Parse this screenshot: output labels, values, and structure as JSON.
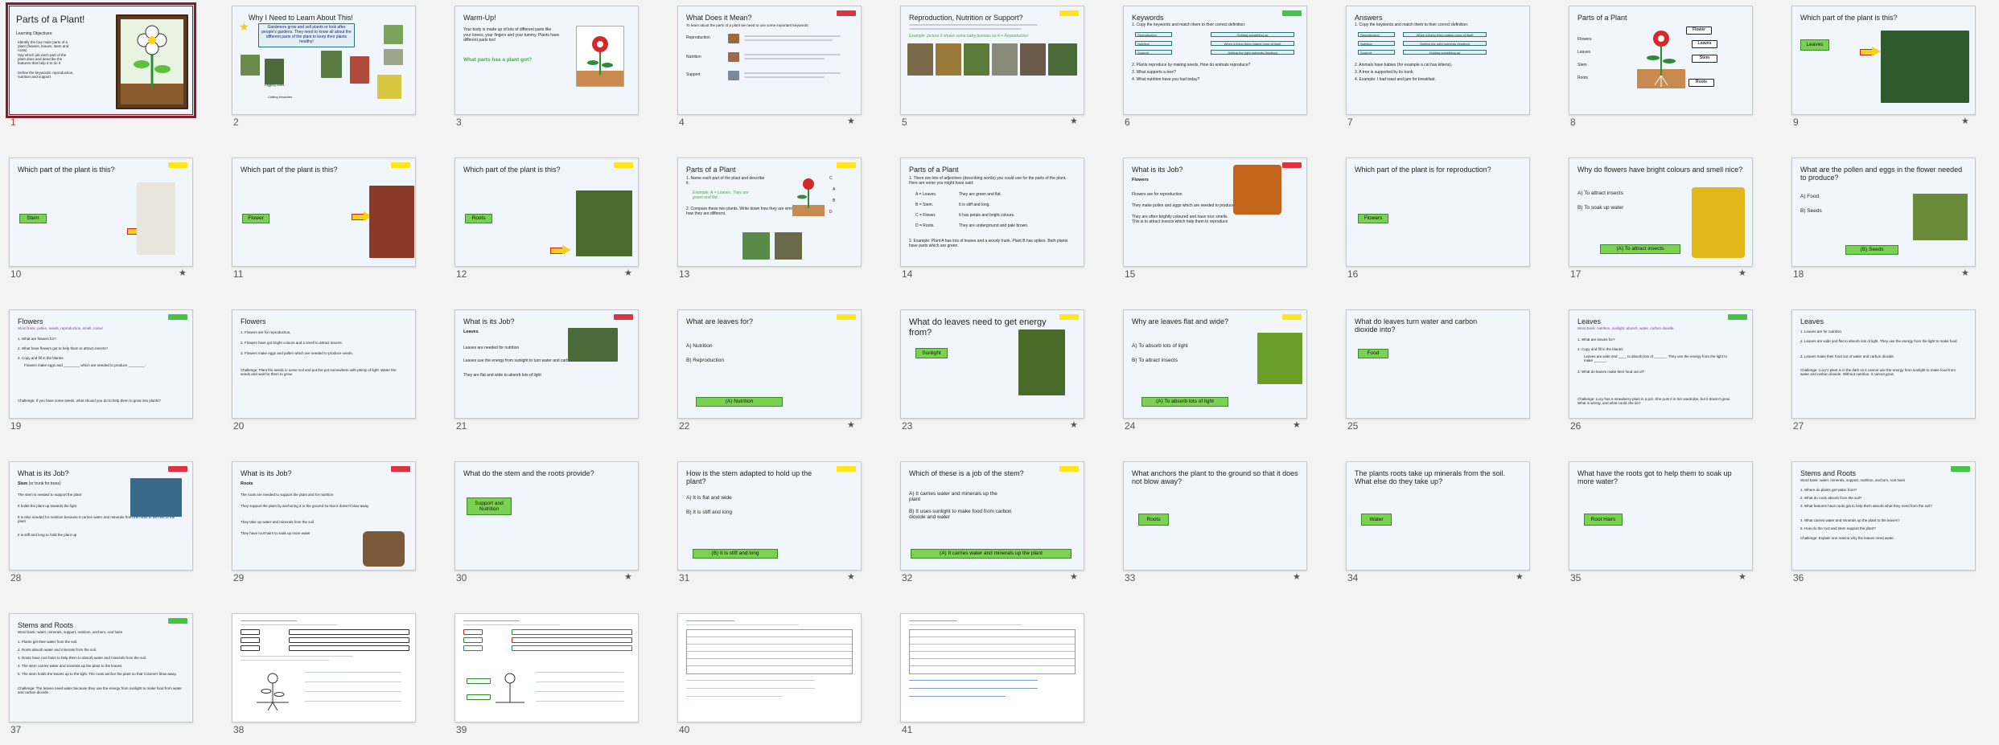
{
  "slides": [
    {
      "n": "1",
      "title": "Parts of a Plant!",
      "star": false,
      "selected": true
    },
    {
      "n": "2",
      "title": "Why I Need to Learn About This!",
      "star": false
    },
    {
      "n": "3",
      "title": "Warm-Up!",
      "star": false
    },
    {
      "n": "4",
      "title": "What Does it Mean?",
      "star": true
    },
    {
      "n": "5",
      "title": "Reproduction, Nutrition or Support?",
      "star": true
    },
    {
      "n": "6",
      "title": "Keywords",
      "star": false
    },
    {
      "n": "7",
      "title": "Answers",
      "star": false
    },
    {
      "n": "8",
      "title": "Parts of a Plant",
      "star": false
    },
    {
      "n": "9",
      "title": "Which part of the plant is this?",
      "star": true
    },
    {
      "n": "10",
      "title": "Which part of the plant is this?",
      "star": true
    },
    {
      "n": "11",
      "title": "Which part of the plant is this?",
      "star": false
    },
    {
      "n": "12",
      "title": "Which part of the plant is this?",
      "star": true
    },
    {
      "n": "13",
      "title": "Parts of a Plant",
      "star": false
    },
    {
      "n": "14",
      "title": "Parts of a Plant",
      "star": false
    },
    {
      "n": "15",
      "title": "What is its Job?",
      "star": false
    },
    {
      "n": "16",
      "title": "Which part of the plant is for reproduction?",
      "star": false
    },
    {
      "n": "17",
      "title": "Why do flowers have bright colours and smell nice?",
      "star": true
    },
    {
      "n": "18",
      "title": "What are the pollen and eggs in the flower needed to produce?",
      "star": true
    },
    {
      "n": "19",
      "title": "Flowers",
      "star": false
    },
    {
      "n": "20",
      "title": "Flowers",
      "star": false
    },
    {
      "n": "21",
      "title": "What is its Job?",
      "star": false
    },
    {
      "n": "22",
      "title": "What are leaves for?",
      "star": true
    },
    {
      "n": "23",
      "title": "What do leaves need to get energy from?",
      "star": true
    },
    {
      "n": "24",
      "title": "Why are leaves flat and wide?",
      "star": true
    },
    {
      "n": "25",
      "title": "What do leaves turn water and carbon dioxide into?",
      "star": true
    },
    {
      "n": "26",
      "title": "Leaves",
      "star": false
    },
    {
      "n": "27",
      "title": "Leaves",
      "star": false
    },
    {
      "n": "28",
      "title": "What is its Job?",
      "star": false
    },
    {
      "n": "29",
      "title": "What is its Job?",
      "star": false
    },
    {
      "n": "30",
      "title": "What do the stem and the roots provide?",
      "star": true
    },
    {
      "n": "31",
      "title": "How is the stem adapted to hold up the plant?",
      "star": true
    },
    {
      "n": "32",
      "title": "Which of these is a job of the stem?",
      "star": true
    },
    {
      "n": "33",
      "title": "What anchors the plant to the ground so that it does not blow away?",
      "star": true
    },
    {
      "n": "34",
      "title": "The plants roots take up minerals from the soil. What else do they take up?",
      "star": true
    },
    {
      "n": "35",
      "title": "What have the roots got to help them to soak up more water?",
      "star": true
    },
    {
      "n": "36",
      "title": "Stems and Roots",
      "star": false
    },
    {
      "n": "37",
      "title": "Stems and Roots",
      "star": false
    },
    {
      "n": "38",
      "title": "",
      "star": false
    },
    {
      "n": "39",
      "title": "",
      "star": false
    },
    {
      "n": "40",
      "title": "",
      "star": false
    },
    {
      "n": "41",
      "title": "",
      "star": false
    }
  ],
  "details": {
    "s1": {
      "objectives": "Learning Objectives:",
      "bullets": [
        "Identify the four main parts of a plant (flowers, leaves, stem and roots)",
        "Say which job each part of the plant does and describe the features that help it to do it",
        "Define the keywords: reproduction, nutrition and support"
      ]
    },
    "s2": {
      "callout": "Gardeners grow and sell plants or look after people's gardens. They need to know all about the different parts of the plant to keep their plants healthy!",
      "labels": [
        "Planting seeds",
        "Digging holes",
        "Cutting branches",
        "Spraying pests",
        "Protecting leaves",
        "Growing beautiful things!"
      ]
    },
    "s3": {
      "intro": "Your body is made up of lots of different parts like your knees, your fingers and your tummy. Plants have different parts too!",
      "question": "What parts has a plant got?"
    },
    "s4": {
      "intro": "To learn about the parts of a plant we need to use some important keywords:",
      "terms": [
        "Reproduction",
        "Nutrition",
        "Support"
      ]
    },
    "s5": {
      "example": "Example: picture 6 shows some baby bunnies so A = Reproduction"
    },
    "s6": {
      "instruction": "1. Copy the keywords and match them to their correct definition:",
      "keywords": [
        "Reproduction",
        "Nutrition",
        "Support"
      ],
      "defs": [
        "Holding something up",
        "When a living thing makes more of itself",
        "Getting the right nutrients (feeding)"
      ],
      "questions": [
        "2. Plants reproduce by making seeds. How do animals reproduce?",
        "3. What supports a tree?",
        "4. What nutrition have you had today?"
      ]
    },
    "s7": {
      "instruction": "1. Copy the keywords and match them to their correct definition:",
      "keywords": [
        "Reproduction",
        "Nutrition",
        "Support"
      ],
      "defs": [
        "When a living thing makes more of itself",
        "Getting the right nutrients (feeding)",
        "Holding something up"
      ],
      "answers": [
        "2. Animals have babies (for example a cat has kittens).",
        "3. A tree is supported by its trunk.",
        "4. Example: I had toast and jam for breakfast."
      ]
    },
    "s8": {
      "parts": [
        "Flowers",
        "Leaves",
        "Stem",
        "Roots"
      ],
      "labels": [
        "Flower",
        "Leaves",
        "Stem",
        "Roots"
      ]
    },
    "answers": {
      "s9": "Leaves",
      "s10": "Stem",
      "s11": "Flower",
      "s12": "Roots",
      "s16": "Flowers",
      "s17": "(A) To attract insects",
      "s18": "(B) Seeds",
      "s22": "(A) Nutrition",
      "s23": "Sunlight",
      "s24": "(A) To absorb lots of light",
      "s25": "Food",
      "s30": "Support and Nutrition",
      "s31": "(B) It is stiff and long",
      "s32": "(A) It carries water and minerals up the plant",
      "s33": "Roots",
      "s34": "Water",
      "s35": "Root Hairs"
    },
    "s13": {
      "items": [
        "1. Name each part of the plant and describe it.",
        "Example: A = Leaves. They are green and flat.",
        "2. Compare these two plants. Write down how they are similar and how they are different."
      ],
      "letters": [
        "A",
        "B",
        "C",
        "D"
      ]
    },
    "s14": {
      "intro": "1. There are lots of adjectives (describing words) you could use for the parts of the plant. Here are some you might have said:",
      "rows": [
        [
          "A = Leaves.",
          "They are green and flat."
        ],
        [
          "B = Stem.",
          "It is stiff and long."
        ],
        [
          "C = Flower.",
          "It has petals and bright colours."
        ],
        [
          "D = Roots.",
          "They are underground and pale brown."
        ]
      ],
      "example": "2. Example: Plant A has lots of leaves and a woody trunk. Plant B has spikes. Both plants have parts which are green."
    },
    "s15": {
      "heading": "Flowers",
      "bullets": [
        "Flowers are for reproduction",
        "They make pollen and eggs which are needed to produce seeds",
        "They are often brightly coloured and have nice smells. This is to attract insects which help them to reproduce"
      ]
    },
    "s17": {
      "options": [
        "A) To attract insects",
        "B) To soak up water"
      ]
    },
    "s18": {
      "options": [
        "A) Food",
        "B) Seeds"
      ]
    },
    "s19": {
      "wordbank": "Word bank: pollen, seeds, reproduction, smell, colour",
      "items": [
        "1. What are flowers for?",
        "2. What have flowers got to help them to attract insects?",
        "3. Copy and fill in the blanks:",
        "Flowers make eggs and ________ which are needed to produce ________."
      ],
      "challenge": "Challenge: If you have some seeds, what should you do to help them to grow into plants?"
    },
    "s20": {
      "items": [
        "1. Flowers are for reproduction.",
        "2. Flowers have got bright colours and a smell to attract insects.",
        "3. Flowers make eggs and pollen which are needed to produce seeds."
      ],
      "challenge": "Challenge: Plant the seeds in some soil and put the pot somewhere with plenty of light. Water the seeds and wait for them to grow."
    },
    "s21": {
      "heading": "Leaves",
      "bullets": [
        "Leaves are needed for nutrition",
        "Leaves use the energy from sunlight to turn water and carbon dioxide into food",
        "They are flat and wide to absorb lots of light"
      ]
    },
    "s22": {
      "options": [
        "A) Nutrition",
        "B) Reproduction"
      ]
    },
    "s24": {
      "options": [
        "A) To absorb lots of light",
        "B) To attract insects"
      ]
    },
    "s26": {
      "wordbank": "Word bank: nutrition, sunlight, absorb, water, carbon dioxide",
      "items": [
        "1. What are leaves for?",
        "2. Copy and fill in the blanks:",
        "Leaves are wide and ____ to absorb lots of ______. They use the energy from the light to make ______.",
        "3. What do leaves make their food out of?"
      ],
      "challenge": "Challenge: Lucy has a strawberry plant in a pot. She puts it in her wardrobe, but it doesn't grow. What is wrong, and what could she do?"
    },
    "s27": {
      "items": [
        "1. Leaves are for nutrition.",
        "2. Leaves are wide and flat to absorb lots of light. They use the energy from the light to make food.",
        "3. Leaves make their food out of water and carbon dioxide."
      ],
      "challenge": "Challenge: Lucy's plant is in the dark so it cannot use the energy from sunlight to make food from water and carbon dioxide. Without nutrition, it cannot grow."
    },
    "s28": {
      "heading": "Stem",
      "headingNote": "(or trunk for trees)",
      "bullets": [
        "The stem is needed to support the plant",
        "It holds the plant up towards the light",
        "It is also needed for nutrition because it carries water and minerals from the roots to the rest of the plant",
        "It is stiff and long to hold the plant up"
      ]
    },
    "s29": {
      "heading": "Roots",
      "bullets": [
        "The roots are needed to support the plant and for nutrition",
        "They support the plant by anchoring it to the ground so that it doesn't blow away",
        "They take up water and minerals from the soil",
        "They have root hairs to soak up more water"
      ]
    },
    "s31": {
      "options": [
        "A) It is flat and wide",
        "B) It is stiff and long"
      ]
    },
    "s32": {
      "options": [
        "A) It carries water and minerals up the plant",
        "B) It uses sunlight to make food from carbon dioxide and water"
      ]
    },
    "s36": {
      "wordbank": "Word bank: water, minerals, support, nutrition, anchors, root hairs",
      "items": [
        "1. Where do plants get water from?",
        "2. What do roots absorb from the soil?",
        "3. What features have roots got to help them absorb what they need from the soil?",
        "4. What carries water and minerals up the plant to the leaves?",
        "5. How do the root and stem support the plant?"
      ],
      "challenge": "Challenge: Explain one reason why the leaves need water."
    },
    "s37": {
      "wordbank": "Word bank: water, minerals, support, nutrition, anchors, root hairs",
      "items": [
        "1. Plants get their water from the soil.",
        "2. Roots absorb water and minerals from the soil.",
        "3. Roots have root hairs to help them to absorb water and minerals from the soil.",
        "4. The stem carries water and minerals up the plant to the leaves.",
        "5. The stem holds the leaves up to the light. The roots anchor the plant so that it doesn't blow away."
      ],
      "challenge": "Challenge: The leaves need water because they use the energy from sunlight to make food from water and carbon dioxide."
    }
  },
  "colors": {
    "accent": "#7a1f2b",
    "answer_green": "#7bd151",
    "tag_yellow": "#ffe51a",
    "tag_red": "#e0323c",
    "tag_green": "#44c545",
    "slide_bg": "#f0f6fb"
  }
}
